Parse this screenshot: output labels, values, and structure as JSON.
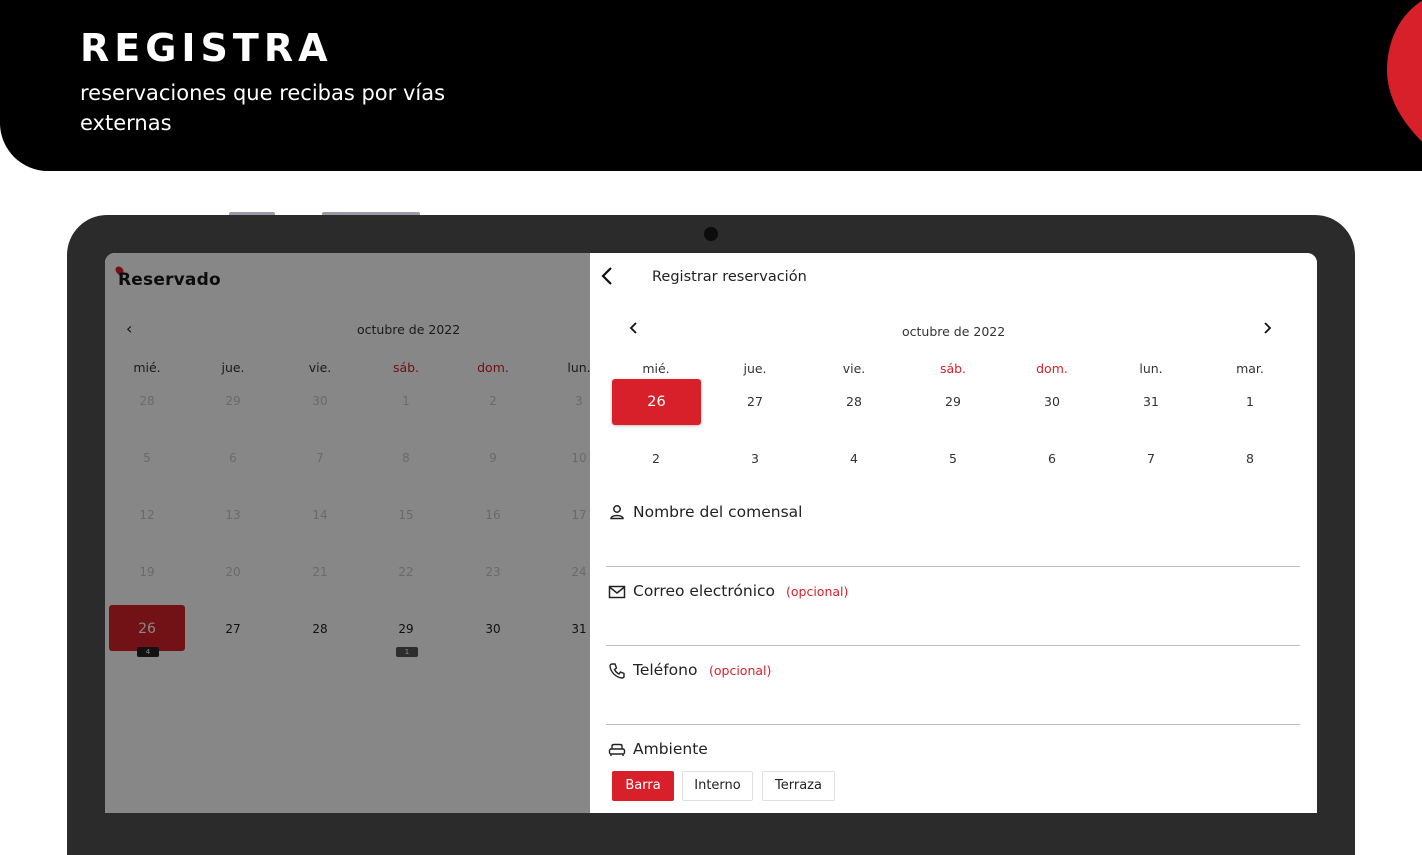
{
  "banner": {
    "title": "REGISTRA",
    "subtitle": "reservaciones que recibas por vías externas"
  },
  "app": {
    "logo_text": "Reservado",
    "accent_color": "#d8202b"
  },
  "left_calendar": {
    "month": "octubre de 2022",
    "weekdays": [
      "mié.",
      "jue.",
      "vie.",
      "sáb.",
      "dom.",
      "lun."
    ],
    "weeks": [
      [
        "28",
        "29",
        "30",
        "1",
        "2",
        "3"
      ],
      [
        "5",
        "6",
        "7",
        "8",
        "9",
        "10"
      ],
      [
        "12",
        "13",
        "14",
        "15",
        "16",
        "17"
      ],
      [
        "19",
        "20",
        "21",
        "22",
        "23",
        "24"
      ],
      [
        "26",
        "27",
        "28",
        "29",
        "30",
        "31"
      ]
    ],
    "badges": {
      "day_26": "4",
      "day_29": "1"
    }
  },
  "form": {
    "title": "Registrar reservación",
    "calendar": {
      "month": "octubre de 2022",
      "weekdays": [
        "mié.",
        "jue.",
        "vie.",
        "sáb.",
        "dom.",
        "lun.",
        "mar."
      ],
      "week1": [
        "26",
        "27",
        "28",
        "29",
        "30",
        "31",
        "1"
      ],
      "week2": [
        "2",
        "3",
        "4",
        "5",
        "6",
        "7",
        "8"
      ],
      "selected": "26"
    },
    "name_label": "Nombre del comensal",
    "email_label": "Correo electrónico",
    "phone_label": "Teléfono",
    "optional_text": "(opcional)",
    "ambiente_label": "Ambiente",
    "ambiente_options": [
      "Barra",
      "Interno",
      "Terraza"
    ],
    "ambiente_selected": "Barra"
  }
}
